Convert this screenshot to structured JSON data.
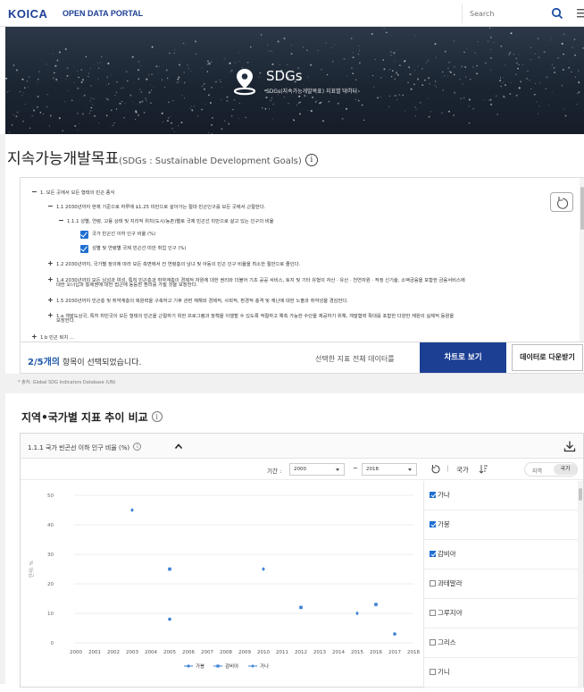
{
  "header": {
    "logo": "KOICA",
    "portal_name": "OPEN DATA PORTAL",
    "search_placeholder": "Search"
  },
  "hero": {
    "title": "SDGs",
    "subtitle": "SDGs(지속가능개발목표) 지표별 데이터"
  },
  "section1": {
    "title": "지속가능개발목표",
    "title_en": "(SDGs : Sustainable Development Goals)",
    "tree": [
      {
        "sym": "−",
        "text": "1. 모든 곳에서 모든 형태의 빈곤 종식"
      },
      {
        "sym": "−",
        "text": "1.1 2030년까지 현재 기준으로 하루에 $1.25 미만으로 살아가는 절대 빈곤인구를 모든 곳에서 근절한다."
      },
      {
        "sym": "−",
        "text": "1.1.1 성별, 연령, 고용 상태 및 지리적 위치(도시/농촌)별로 국제 빈곤선 미만으로 살고 있는 인구의 비율"
      },
      {
        "sym": "check",
        "text": "국가 빈곤선 이하 인구 비율 (%)"
      },
      {
        "sym": "check",
        "text": "성별 및 연령별 국제 빈곤선 미만 취업 인구 (%)"
      },
      {
        "sym": "+",
        "text": "1.2 2030년까지, 국가별 정의에 따라 모든 측면에서 전 연령층의 남녀 및 아동의 빈곤 인구 비율을 최소한 절반으로 줄인다."
      },
      {
        "sym": "+",
        "text": "1.4 2030년까지 모든 남성과 여성, 특히 빈곤층과 취약계층이 경제적 자원에 대한 권리와 더불어 기초 공공 서비스, 토지 및 기타 유형의 자산 · 유산 · 천연자원 · 적정 신기술, 소액금융을 포함한 금융서비스에"
      },
      {
        "sym": "",
        "text": "대한 오너십과 통제권에 대한 접근에 동등한 권리를 가질 것을 보장한다."
      },
      {
        "sym": "+",
        "text": "1.5 2030년까지 빈곤층 및 취약계층의 복원력을 구축하고 기후 관련 재해와 경제적, 사회적, 환경적 충격 및 재난에 대한 노출과 취약성을 경감한다."
      },
      {
        "sym": "+",
        "text": "1.a 개발도상국, 특히 최빈국이 모든 형태의 빈곤을 근절하기 위한 프로그램과 정책을 이행할 수 있도록 적절하고 예측 가능한 수단을 제공하기 위해, 개발협력 확대를 포함한 다양한 재원의 실제적 동원을"
      },
      {
        "sym": "",
        "text": "보장한다."
      },
      {
        "sym": "+",
        "text": "1.b 빈곤 퇴치 ..."
      }
    ],
    "selected_count": "2/5개의",
    "selected_suffix": " 항목이 선택되었습니다.",
    "select_all_label": "선택한 지표 전체 데이터를",
    "chart_button": "차트로 보기",
    "download_button": "데이터로 다운받기",
    "source": "* 출처: Global SDG Indicators Database (UN)"
  },
  "section2": {
    "title": "지역•국가별 지표 추이 비교",
    "indicator_name": "1.1.1 국가 빈곤선 이하 인구 비율 (%)",
    "period_label": "기간 :",
    "period_from": "2000",
    "period_to": "2018",
    "tilde": "~",
    "separator": "|",
    "country_label": "국가",
    "toggle_region": "지역",
    "toggle_country": "국가",
    "countries": [
      {
        "name": "가나",
        "checked": true
      },
      {
        "name": "가봉",
        "checked": true
      },
      {
        "name": "감비아",
        "checked": true
      },
      {
        "name": "과테말라",
        "checked": false
      },
      {
        "name": "그루지야",
        "checked": false
      },
      {
        "name": "그리스",
        "checked": false
      },
      {
        "name": "기니",
        "checked": false
      }
    ]
  },
  "chart_data": {
    "type": "scatter",
    "ylabel": "단위: %",
    "ylim": [
      0,
      50
    ],
    "yticks": [
      0,
      10,
      20,
      30,
      40,
      50
    ],
    "x": [
      "2000",
      "2001",
      "2002",
      "2003",
      "2004",
      "2005",
      "2006",
      "2007",
      "2008",
      "2009",
      "2010",
      "2011",
      "2012",
      "2013",
      "2014",
      "2015",
      "2016",
      "2017",
      "2018"
    ],
    "series": [
      {
        "name": "가봉",
        "color": "#3b82d6",
        "marker": "circle",
        "points": [
          [
            2005,
            8
          ],
          [
            2017,
            3
          ]
        ]
      },
      {
        "name": "감비아",
        "color": "#3b82d6",
        "marker": "square",
        "points": [
          [
            2005,
            25
          ],
          [
            2012,
            12
          ],
          [
            2016,
            13
          ]
        ]
      },
      {
        "name": "가나",
        "color": "#3b82d6",
        "marker": "diamond",
        "points": [
          [
            2003,
            45
          ],
          [
            2010,
            25
          ],
          [
            2015,
            10
          ]
        ]
      }
    ],
    "legend_position": "bottom"
  }
}
